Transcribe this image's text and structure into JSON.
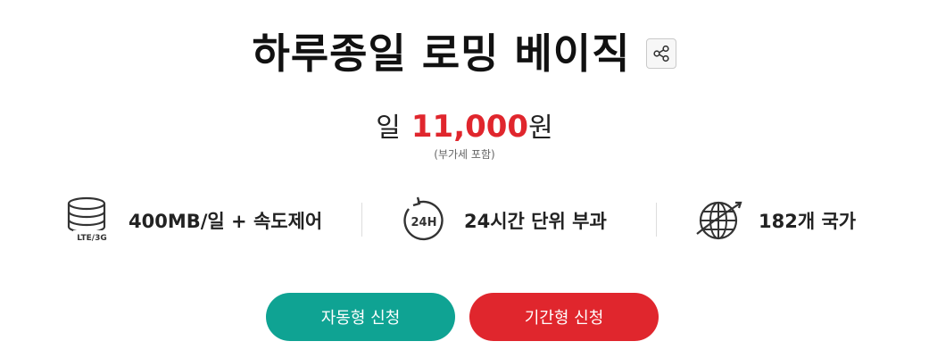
{
  "title": "하루종일 로밍 베이직",
  "share": {
    "icon": "share-icon"
  },
  "price": {
    "prefix": "일",
    "amount": "11,000",
    "unit": "원",
    "vat_note": "(부가세 포함)"
  },
  "features": [
    {
      "icon": "lte-3g-data-icon",
      "icon_text": "LTE/3G",
      "label": "400MB/일 + 속도제어"
    },
    {
      "icon": "24h-clock-icon",
      "icon_text": "24H",
      "label": "24시간 단위 부과"
    },
    {
      "icon": "globe-icon",
      "label": "182개 국가"
    }
  ],
  "buttons": {
    "auto_label": "자동형 신청",
    "period_label": "기간형 신청"
  },
  "colors": {
    "accent_red": "#e0262d",
    "accent_teal": "#0fa393"
  }
}
